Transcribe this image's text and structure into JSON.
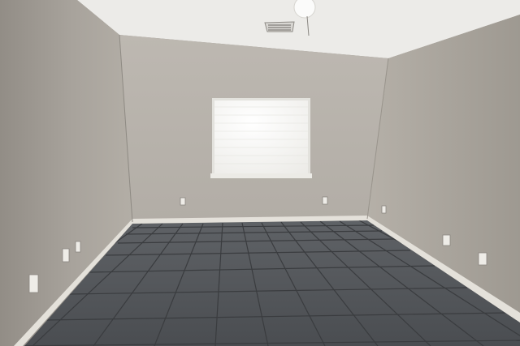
{
  "scene": {
    "type": "photo",
    "subject": "empty-room",
    "colors": {
      "ceiling": "#ecebe8",
      "back_wall": "#b9b4ad",
      "left_wall": "#a19c95",
      "right_wall": "#aca79f",
      "baseboard": "#e4e1da",
      "floor_tile": "#4f5256",
      "grout": "#3a3c3f",
      "window_glow": "#f7f7f5"
    }
  }
}
